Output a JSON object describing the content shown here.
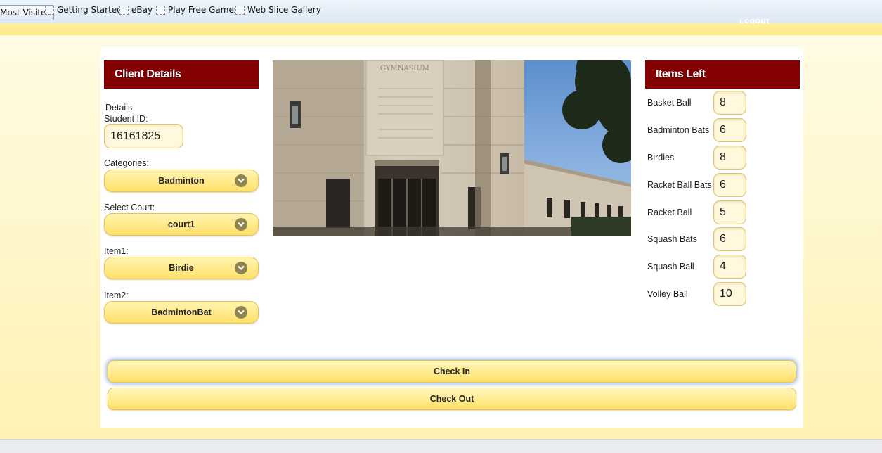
{
  "bookmarks": {
    "items": [
      {
        "label": "Most Visited"
      },
      {
        "label": "Getting Started"
      },
      {
        "label": "eBay"
      },
      {
        "label": "Play Free Games"
      },
      {
        "label": "Web Slice Gallery"
      }
    ]
  },
  "header": {
    "logout_label": "Logout"
  },
  "client": {
    "title": "Client Details",
    "details_label": "Details",
    "student_id_label": "Student ID:",
    "student_id_value": "16161825",
    "categories_label": "Categories:",
    "categories_value": "Badminton",
    "court_label": "Select Court:",
    "court_value": "court1",
    "item1_label": "Item1:",
    "item1_value": "Birdie",
    "item2_label": "Item2:",
    "item2_value": "BadmintonBat"
  },
  "items_left": {
    "title": "Items Left",
    "items": [
      {
        "label": "Basket Ball",
        "count": "8"
      },
      {
        "label": "Badminton Bats",
        "count": "6"
      },
      {
        "label": "Birdies",
        "count": "8"
      },
      {
        "label": "Racket Ball Bats",
        "count": "6"
      },
      {
        "label": "Racket Ball",
        "count": "5"
      },
      {
        "label": "Squash Bats",
        "count": "6"
      },
      {
        "label": "Squash Ball",
        "count": "4"
      },
      {
        "label": "Volley Ball",
        "count": "10"
      }
    ]
  },
  "photo": {
    "engraved_title": "GYMNASIUM"
  },
  "actions": {
    "check_in": "Check In",
    "check_out": "Check Out"
  },
  "colors": {
    "header_red": "#850000",
    "button_yellow": "#ffe06a",
    "page_yellow": "#fff6c8"
  }
}
